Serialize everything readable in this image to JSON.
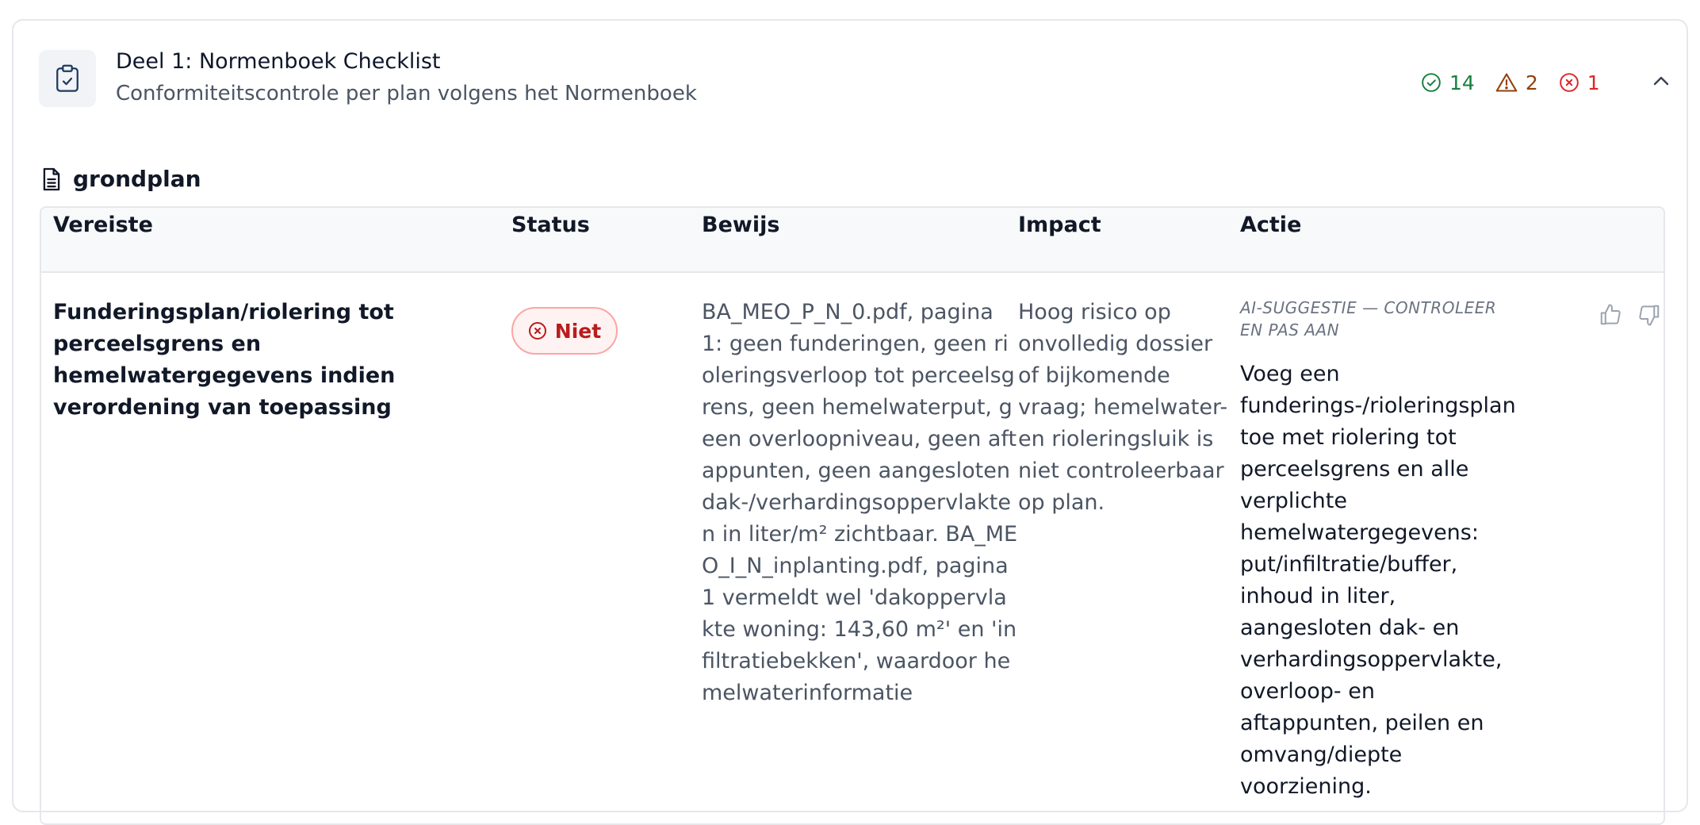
{
  "header": {
    "title": "Deel 1: Normenboek Checklist",
    "subtitle": "Conformiteitscontrole per plan volgens het Normenboek",
    "icon": "clipboard-check-icon",
    "counts": {
      "pass": "14",
      "warning": "2",
      "fail": "1"
    },
    "colors": {
      "pass": "#15803d",
      "warning": "#92400e",
      "fail": "#dc2626"
    }
  },
  "section": {
    "icon": "document-icon",
    "title": "grondplan"
  },
  "table": {
    "columns": [
      "Vereiste",
      "Status",
      "Bewijs",
      "Impact",
      "Actie"
    ],
    "rows": [
      {
        "requirement": "Funderingsplan/riolering tot perceelsgrens en hemelwatergegevens indien verordening van toepassing",
        "status": "Niet",
        "evidence": "BA_MEO_P_N_0.pdf, pagina 1: geen funderingen, geen rioleringsverloop tot perceelsgrens, geen hemelwaterput, geen overloopniveau, geen aftappunten, geen aangesloten dak-/verhardingsoppervlakten in liter/m² zichtbaar. BA_MEO_I_N_inplanting.pdf, pagina 1 vermeldt wel 'dakoppervlakte woning: 143,60 m²' en 'infiltratiebekken', waardoor hemelwaterinformatie",
        "impact": "Hoog risico op onvolledig dossier of bijkomende vraag; hemelwater- en rioleringsluik is niet controleerbaar op plan.",
        "ai_label": "AI-suggestie — controleer en pas aan",
        "action": "Voeg een funderings-/rioleringsplan toe met riolering tot perceelsgrens en alle verplichte hemelwatergegevens: put/infiltratie/buffer, inhoud in liter, aangesloten dak- en verhardingsoppervlakte, overloop- en aftappunten, peilen en omvang/diepte voorziening."
      }
    ]
  }
}
